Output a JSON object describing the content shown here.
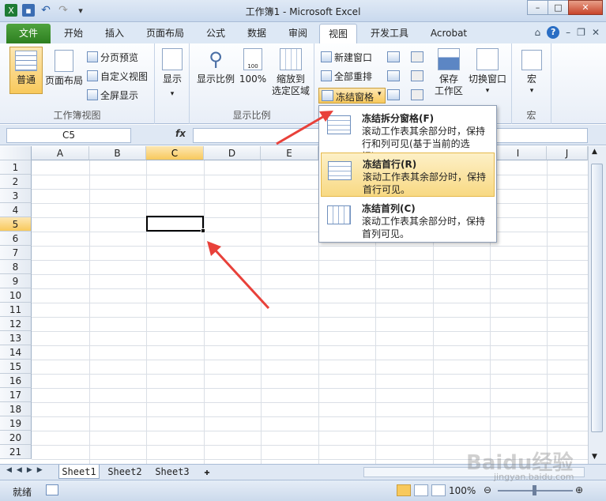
{
  "window": {
    "title": "工作簿1 - Microsoft Excel"
  },
  "tabs": [
    "文件",
    "开始",
    "插入",
    "页面布局",
    "公式",
    "数据",
    "审阅",
    "视图",
    "开发工具",
    "Acrobat"
  ],
  "ribbon": {
    "groups": {
      "workbook_views": "工作簿视图",
      "zoom": "显示比例",
      "macros": "宏"
    },
    "normal": "普通",
    "page_layout": "页面布局",
    "page_break_preview": "分页预览",
    "custom_views": "自定义视图",
    "full_screen": "全屏显示",
    "show": "显示",
    "zoom": "显示比例",
    "zoom_100": "100%",
    "zoom_selection_1": "缩放到",
    "zoom_selection_2": "选定区域",
    "new_window": "新建窗口",
    "arrange_all": "全部重排",
    "freeze_panes": "冻结窗格",
    "save_1": "保存",
    "save_2": "工作区",
    "switch_windows": "切换窗口",
    "macros": "宏",
    "zoom_icon_value": "100"
  },
  "formula_bar": {
    "name_box": "C5",
    "fx": "fx",
    "content": ""
  },
  "grid": {
    "columns": [
      "A",
      "B",
      "C",
      "D",
      "E",
      "F",
      "G",
      "H",
      "I",
      "J"
    ],
    "selected_column": "C",
    "rows": [
      "1",
      "2",
      "3",
      "4",
      "5",
      "6",
      "7",
      "8",
      "9",
      "10",
      "11",
      "12",
      "13",
      "14",
      "15",
      "16",
      "17",
      "18",
      "19",
      "20",
      "21"
    ],
    "selected_row": "5",
    "active_cell": "C5"
  },
  "freeze_menu": {
    "items": [
      {
        "title": "冻结拆分窗格(F)",
        "desc": "滚动工作表其余部分时，保持行和列可见(基于当前的选择)。"
      },
      {
        "title": "冻结首行(R)",
        "desc": "滚动工作表其余部分时，保持首行可见。"
      },
      {
        "title": "冻结首列(C)",
        "desc": "滚动工作表其余部分时，保持首列可见。"
      }
    ],
    "highlighted_index": 1
  },
  "sheets": [
    "Sheet1",
    "Sheet2",
    "Sheet3"
  ],
  "active_sheet": "Sheet1",
  "status": {
    "ready": "就绪",
    "zoom": "100%"
  },
  "watermark": {
    "brand": "Baidu经验",
    "url": "jingyan.baidu.com"
  },
  "colors": {
    "accent": "#f8c95c",
    "file_tab": "#2d7f20",
    "arrow": "#e8413a"
  }
}
